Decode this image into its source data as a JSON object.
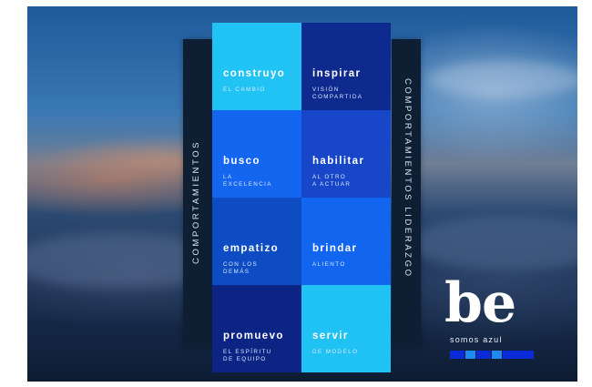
{
  "left_label": "COMPORTAMIENTOS",
  "right_label": "COMPORTAMIENTOS LIDERAZGO",
  "cells": [
    {
      "title": "construyo",
      "subtitle": "EL CAMBIO",
      "color": "#21c3f4"
    },
    {
      "title": "inspirar",
      "subtitle": "VISIÓN\nCOMPARTIDA",
      "color": "#0e2a8f"
    },
    {
      "title": "busco",
      "subtitle": "LA\nEXCELENCIA",
      "color": "#1466f0"
    },
    {
      "title": "habilitar",
      "subtitle": "AL OTRO\nA ACTUAR",
      "color": "#1747c8"
    },
    {
      "title": "empatizo",
      "subtitle": "CON LOS\nDEMÁS",
      "color": "#0e4cc4"
    },
    {
      "title": "brindar",
      "subtitle": "ALIENTO",
      "color": "#1265ef"
    },
    {
      "title": "promuevo",
      "subtitle": "EL ESPÍRITU\nDE EQUIPO",
      "color": "#0c2585"
    },
    {
      "title": "servir",
      "subtitle": "DE MODELO",
      "color": "#20c1f3"
    }
  ],
  "logo": {
    "text": "be",
    "tagline": "somos azul"
  },
  "logo_squares": [
    "#0b2bd6",
    "#1f8bf0",
    "#0b2bd6",
    "#1f8bf0",
    "#0b2bd6"
  ]
}
